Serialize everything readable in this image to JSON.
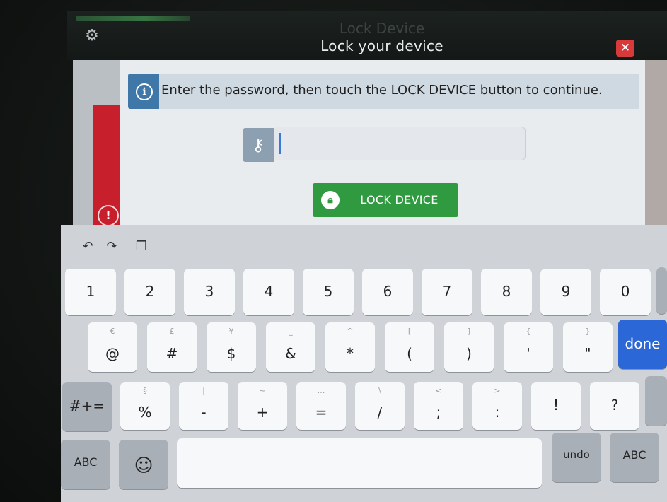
{
  "app": {
    "background_title": "Lock Device",
    "dialog_title": "Lock your device",
    "close_glyph": "✕"
  },
  "info": {
    "icon": "i",
    "message": "Enter the password, then touch the LOCK DEVICE button to continue."
  },
  "password": {
    "value": "",
    "placeholder": ""
  },
  "lock_button": {
    "label": "LOCK DEVICE"
  },
  "alert_glyph": "!",
  "keyboard": {
    "toolbar": {
      "undo": "↶",
      "redo": "↷",
      "paste": "❐"
    },
    "row1": [
      "1",
      "2",
      "3",
      "4",
      "5",
      "6",
      "7",
      "8",
      "9",
      "0"
    ],
    "row2": [
      {
        "main": "@",
        "hint": "€"
      },
      {
        "main": "#",
        "hint": "£"
      },
      {
        "main": "$",
        "hint": "¥"
      },
      {
        "main": "&",
        "hint": "_"
      },
      {
        "main": "*",
        "hint": "^"
      },
      {
        "main": "(",
        "hint": "["
      },
      {
        "main": ")",
        "hint": "]"
      },
      {
        "main": "'",
        "hint": "{"
      },
      {
        "main": "\"",
        "hint": "}"
      }
    ],
    "done": "done",
    "symbols_toggle": "#+=",
    "row3": [
      {
        "main": "%",
        "hint": "§"
      },
      {
        "main": "-",
        "hint": "|"
      },
      {
        "main": "+",
        "hint": "~"
      },
      {
        "main": "=",
        "hint": "…"
      },
      {
        "main": "/",
        "hint": "\\"
      },
      {
        "main": ";",
        "hint": "<"
      },
      {
        "main": ":",
        "hint": ">"
      },
      {
        "main": "!",
        "hint": ""
      },
      {
        "main": "?",
        "hint": ""
      }
    ],
    "abc_left": "ABC",
    "emoji": "☺",
    "undo": "undo",
    "abc_right": "ABC"
  },
  "colors": {
    "lock_button": "#2f9a3f",
    "close_button": "#d63a3a",
    "info_icon": "#3f78a8",
    "done_key": "#2b67d6",
    "alert_bar": "#c7202c"
  }
}
